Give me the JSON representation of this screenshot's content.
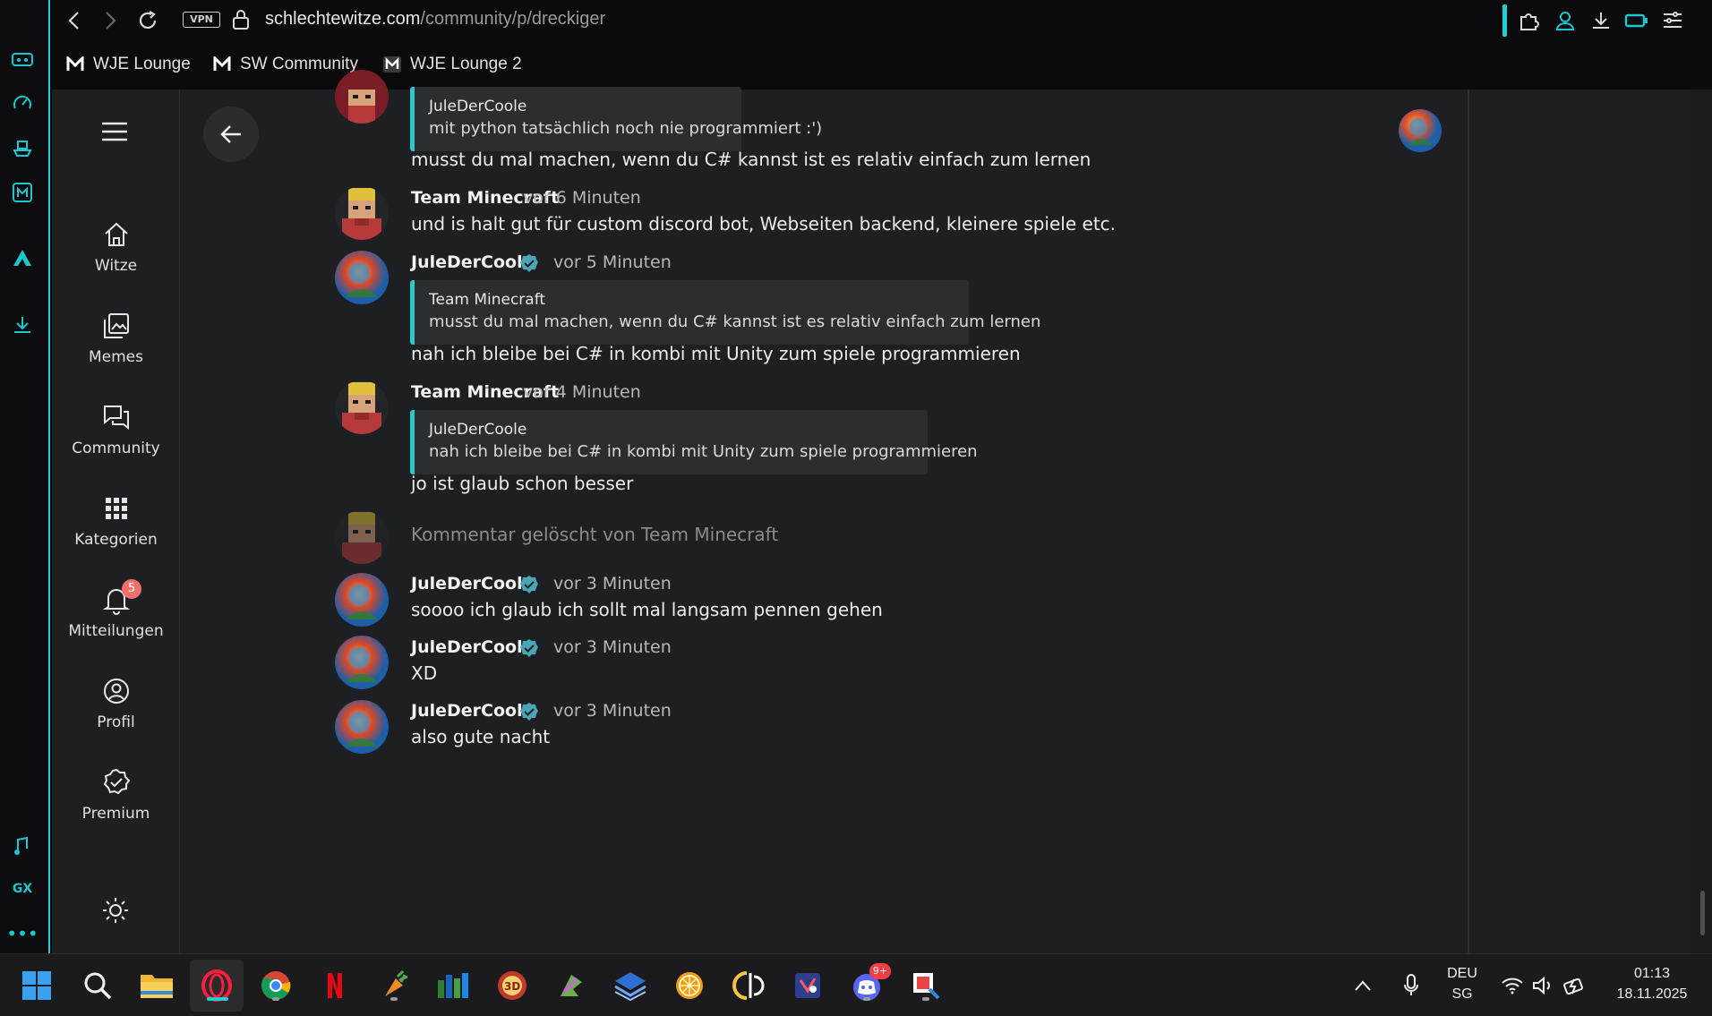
{
  "browser": {
    "url_host": "schlechtewitze.com",
    "url_path": "/community/p/dreckiger",
    "vpn_label": "VPN",
    "bookmarks": [
      {
        "label": "WJE Lounge"
      },
      {
        "label": "SW Community"
      },
      {
        "label": "WJE Lounge 2"
      }
    ],
    "accent_color": "#1fd1d6"
  },
  "site_nav": {
    "items": [
      {
        "label": "Witze",
        "icon": "home-icon"
      },
      {
        "label": "Memes",
        "icon": "image-gallery-icon"
      },
      {
        "label": "Community",
        "icon": "chat-bubbles-icon"
      },
      {
        "label": "Kategorien",
        "icon": "grid-icon"
      },
      {
        "label": "Mitteilungen",
        "icon": "bell-icon"
      },
      {
        "label": "Profil",
        "icon": "user-circle-icon"
      },
      {
        "label": "Premium",
        "icon": "badge-check-icon"
      }
    ],
    "notification_count": "5"
  },
  "comments": [
    {
      "quote": {
        "author": "JuleDerCoole",
        "text": "mit python tatsächlich noch nie programmiert :')"
      },
      "text": "musst du mal machen, wenn du C# kannst ist es relativ einfach zum lernen"
    },
    {
      "author": "Team Minecraft",
      "time": "vor 6 Minuten",
      "text": "und is halt gut für custom discord bot, Webseiten backend, kleinere spiele etc."
    },
    {
      "author": "JuleDerCoole",
      "verified": true,
      "time": "vor 5 Minuten",
      "quote": {
        "author": "Team Minecraft",
        "text": "musst du mal machen, wenn du C# kannst ist es relativ einfach zum lernen"
      },
      "text": "nah ich bleibe bei C# in kombi mit Unity zum spiele programmieren"
    },
    {
      "author": "Team Minecraft",
      "time": "vor 4 Minuten",
      "quote": {
        "author": "JuleDerCoole",
        "text": "nah ich bleibe bei C# in kombi mit Unity zum spiele programmieren"
      },
      "text": "jo ist glaub schon besser"
    },
    {
      "deleted_text": "Kommentar gelöscht von Team Minecraft"
    },
    {
      "author": "JuleDerCoole",
      "verified": true,
      "time": "vor 3 Minuten",
      "text": "soooo ich glaub ich sollt mal langsam pennen gehen"
    },
    {
      "author": "JuleDerCoole",
      "verified": true,
      "time": "vor 3 Minuten",
      "text": "XD"
    },
    {
      "author": "JuleDerCoole",
      "verified": true,
      "time": "vor 3 Minuten",
      "text": "also gute nacht"
    }
  ],
  "taskbar": {
    "language": "DEU",
    "layout": "SG",
    "time": "01:13",
    "date": "18.11.2025",
    "discord_badge": "9+"
  }
}
